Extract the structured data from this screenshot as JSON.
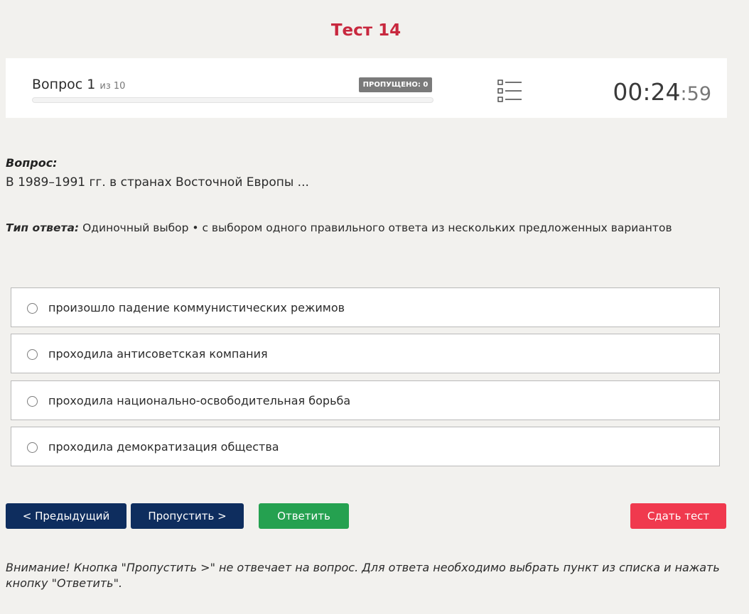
{
  "page": {
    "title": "Тест 14"
  },
  "status": {
    "question_label": "Вопрос 1",
    "of_label": "из 10",
    "skipped_badge": "ПРОПУЩЕНО: 0",
    "progress_fraction": 0.0,
    "questions_list_icon": "list-icon",
    "timer": {
      "hours": "00",
      "minutes": "24",
      "seconds": "59"
    }
  },
  "question": {
    "label": "Вопрос:",
    "text": "В 1989–1991 гг. в странах Восточной Европы ..."
  },
  "answer_type": {
    "label": "Тип ответа:",
    "value": "Одиночный выбор • с выбором одного правильного ответа из нескольких предложенных вариантов"
  },
  "options": [
    {
      "label": "произошло падение коммунистических режимов",
      "selected": false
    },
    {
      "label": "проходила антисоветская компания",
      "selected": false
    },
    {
      "label": "проходила национально-освободительная борьба",
      "selected": false
    },
    {
      "label": "проходила демократизация общества",
      "selected": false
    }
  ],
  "buttons": {
    "prev": "< Предыдущий",
    "skip": "Пропустить >",
    "answer": "Ответить",
    "submit": "Сдать тест"
  },
  "colors": {
    "title": "#c8283e",
    "nav_button": "#0e2d5e",
    "answer_button": "#25a150",
    "submit_button": "#f0394e",
    "badge": "#7a7a7a"
  },
  "notice": "Внимание! Кнопка \"Пропустить >\" не отвечает на вопрос. Для ответа необходимо выбрать пункт из списка и нажать кнопку \"Ответить\"."
}
